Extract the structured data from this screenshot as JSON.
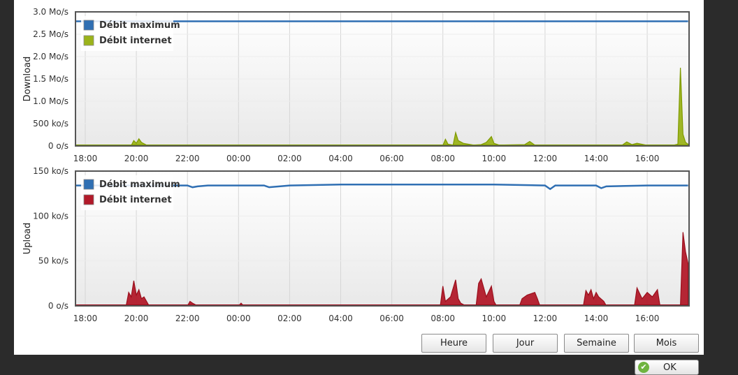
{
  "colors": {
    "max_line": "#2f6fb3",
    "download_fill": "#9bb31a",
    "download_stroke": "#7f9a00",
    "upload_fill": "#b21a2a",
    "upload_stroke": "#9a0f1c",
    "grid": "#d6d6d6",
    "frame": "#555555"
  },
  "chart_data": [
    {
      "type": "area",
      "ylabel": "Download",
      "y_ticks": [
        "0 o/s",
        "500 ko/s",
        "1.0 Mo/s",
        "1.5 Mo/s",
        "2.0 Mo/s",
        "2.5 Mo/s",
        "3.0 Mo/s"
      ],
      "ylim": [
        0,
        3000
      ],
      "y_unit_note": "ko/s",
      "x_ticks": [
        "18:00",
        "20:00",
        "22:00",
        "00:00",
        "02:00",
        "04:00",
        "06:00",
        "08:00",
        "10:00",
        "12:00",
        "14:00",
        "16:00"
      ],
      "x_range_hours": [
        17.6,
        41.6
      ],
      "legend": [
        "Débit maximum",
        "Débit internet"
      ],
      "legend_placement": "top-left",
      "grid": true,
      "series": [
        {
          "name": "Débit maximum",
          "type": "line",
          "x": [
            17.6,
            20.0,
            24.0,
            28.0,
            30.0,
            32.0,
            36.0,
            41.6
          ],
          "values": [
            2790,
            2790,
            2790,
            2790,
            2790,
            2790,
            2790,
            2790
          ]
        },
        {
          "name": "Débit internet",
          "type": "area",
          "x": [
            17.6,
            19.8,
            19.9,
            20.0,
            20.1,
            20.2,
            20.4,
            22.0,
            24.0,
            28.0,
            32.0,
            32.1,
            32.2,
            32.4,
            32.5,
            32.6,
            32.8,
            33.2,
            33.5,
            33.7,
            33.9,
            34.0,
            34.2,
            35.2,
            35.4,
            35.6,
            37.0,
            39.0,
            39.2,
            39.4,
            39.6,
            40.0,
            41.0,
            41.2,
            41.3,
            41.4,
            41.5,
            41.6
          ],
          "values": [
            10,
            10,
            120,
            60,
            160,
            80,
            20,
            10,
            10,
            10,
            10,
            150,
            40,
            20,
            300,
            120,
            60,
            20,
            30,
            80,
            210,
            60,
            20,
            30,
            100,
            20,
            10,
            10,
            90,
            30,
            60,
            15,
            15,
            40,
            1750,
            260,
            80,
            40
          ]
        }
      ]
    },
    {
      "type": "area",
      "ylabel": "Upload",
      "y_ticks": [
        "0 o/s",
        "50 ko/s",
        "100 ko/s",
        "150 ko/s"
      ],
      "ylim": [
        0,
        150
      ],
      "x_ticks": [
        "18:00",
        "20:00",
        "22:00",
        "00:00",
        "02:00",
        "04:00",
        "06:00",
        "08:00",
        "10:00",
        "12:00",
        "14:00",
        "16:00"
      ],
      "x_range_hours": [
        17.6,
        41.6
      ],
      "legend": [
        "Débit maximum",
        "Débit internet"
      ],
      "legend_placement": "top-left",
      "grid": true,
      "series": [
        {
          "name": "Débit maximum",
          "type": "line",
          "x": [
            17.6,
            22.0,
            22.2,
            22.4,
            22.8,
            25.0,
            25.2,
            25.6,
            26.0,
            28.0,
            34.0,
            36.0,
            36.2,
            36.4,
            38.0,
            38.2,
            38.4,
            40.0,
            41.6
          ],
          "values": [
            134,
            134,
            132,
            133,
            134,
            134,
            132,
            133,
            134,
            135,
            135,
            134,
            130,
            134,
            134,
            131,
            133,
            134,
            134
          ]
        },
        {
          "name": "Débit internet",
          "type": "area",
          "x": [
            17.6,
            19.6,
            19.7,
            19.8,
            19.9,
            20.0,
            20.1,
            20.2,
            20.3,
            20.5,
            22.0,
            22.1,
            22.2,
            22.4,
            24.0,
            24.1,
            24.2,
            28.0,
            31.9,
            32.0,
            32.1,
            32.3,
            32.5,
            32.6,
            32.7,
            32.9,
            33.3,
            33.4,
            33.5,
            33.7,
            33.9,
            34.0,
            34.1,
            35.0,
            35.1,
            35.3,
            35.6,
            35.7,
            35.8,
            36.5,
            37.5,
            37.6,
            37.7,
            37.8,
            37.9,
            38.0,
            38.1,
            38.3,
            38.4,
            38.6,
            39.5,
            39.6,
            39.8,
            40.0,
            40.2,
            40.4,
            40.5,
            41.0,
            41.3,
            41.4,
            41.5,
            41.6
          ],
          "values": [
            0,
            0,
            15,
            10,
            28,
            12,
            18,
            8,
            10,
            0,
            0,
            5,
            3,
            0,
            0,
            3,
            0,
            0,
            0,
            22,
            5,
            10,
            29,
            8,
            3,
            0,
            0,
            25,
            30,
            10,
            22,
            5,
            0,
            0,
            8,
            12,
            15,
            8,
            0,
            0,
            0,
            17,
            12,
            18,
            8,
            15,
            10,
            5,
            0,
            0,
            0,
            20,
            8,
            15,
            10,
            18,
            0,
            0,
            0,
            82,
            60,
            47
          ]
        }
      ]
    }
  ],
  "buttons": {
    "hour": "Heure",
    "day": "Jour",
    "week": "Semaine",
    "month": "Mois",
    "ok": "OK"
  }
}
